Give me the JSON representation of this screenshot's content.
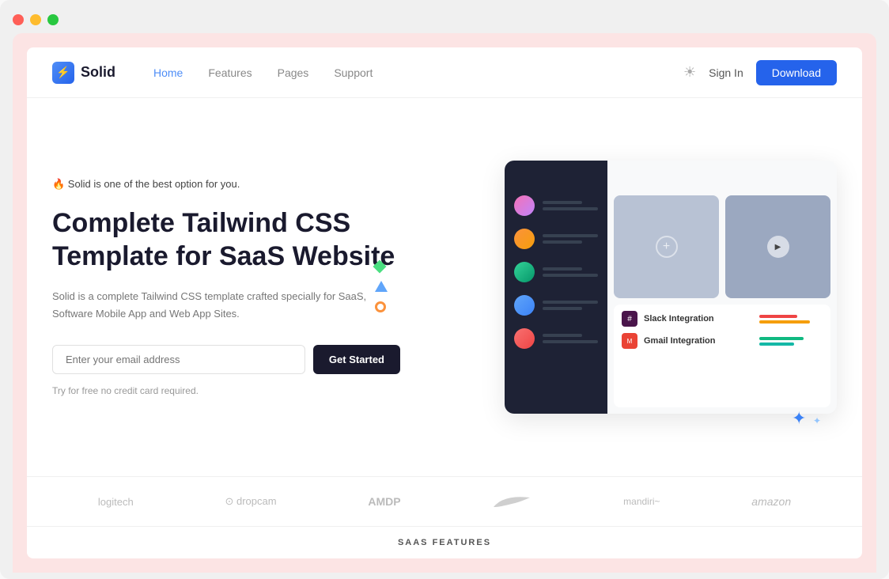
{
  "browser": {
    "dots": [
      "red",
      "yellow",
      "green"
    ]
  },
  "navbar": {
    "logo": "Solid",
    "logo_icon": "⚡",
    "nav_links": [
      {
        "label": "Home",
        "active": true
      },
      {
        "label": "Features",
        "active": false
      },
      {
        "label": "Pages",
        "active": false
      },
      {
        "label": "Support",
        "active": false
      }
    ],
    "sign_in": "Sign In",
    "download": "Download"
  },
  "hero": {
    "badge": "🔥 Solid is one of the best option for you.",
    "title_line1": "Complete Tailwind CSS",
    "title_line2": "Template for SaaS Website",
    "description": "Solid is a complete Tailwind CSS template crafted specially for SaaS,\nSoftware Mobile App and Web App Sites.",
    "email_placeholder": "Enter your email address",
    "cta_button": "Get Started",
    "try_free": "Try for free no credit card required."
  },
  "integrations": [
    {
      "name": "Slack Integration",
      "type": "slack"
    },
    {
      "name": "Gmail Integration",
      "type": "gmail"
    }
  ],
  "brands": [
    "logitech",
    "dropcam",
    "AMDP",
    "nike",
    "mandiri",
    "amazon"
  ],
  "saas_section": "SAAS FEATURES",
  "colors": {
    "primary": "#2563eb",
    "dark": "#1a1a2e",
    "accent_green": "#4ade80",
    "accent_blue": "#60a5fa",
    "accent_orange": "#fb923c"
  }
}
